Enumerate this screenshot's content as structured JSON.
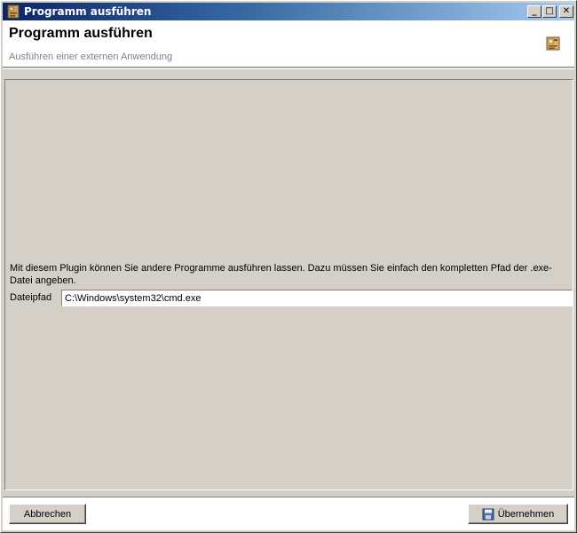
{
  "window": {
    "title": "Programm ausführen",
    "minimize_glyph": "_",
    "maximize_glyph": "□",
    "close_glyph": "✕"
  },
  "header": {
    "title": "Programm ausführen",
    "subtitle": "Ausführen einer externen Anwendung",
    "icon": "program-icon"
  },
  "main": {
    "description": "Mit diesem Plugin können Sie andere Programme ausführen lassen. Dazu müssen Sie einfach den kompletten Pfad der .exe-Datei angeben.",
    "path_label": "Dateipfad",
    "path_value": "C:\\Windows\\system32\\cmd.exe"
  },
  "footer": {
    "cancel_label": "Abbrechen",
    "apply_label": "Übernehmen",
    "apply_icon": "save-icon"
  }
}
